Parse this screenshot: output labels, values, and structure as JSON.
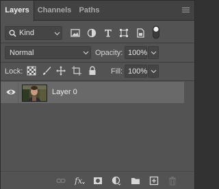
{
  "tabs": [
    {
      "label": "Layers",
      "active": true
    },
    {
      "label": "Channels",
      "active": false
    },
    {
      "label": "Paths",
      "active": false
    }
  ],
  "filter": {
    "kind_label": "Kind",
    "icons": [
      "image-filter-icon",
      "adjustment-filter-icon",
      "type-filter-icon",
      "shape-filter-icon",
      "smart-object-filter-icon",
      "filter-toggle-icon"
    ]
  },
  "blend": {
    "mode": "Normal",
    "opacity_label": "Opacity:",
    "opacity_value": "100%"
  },
  "lock": {
    "label": "Lock:",
    "icons": [
      "lock-transparent-pixels-icon",
      "lock-image-pixels-icon",
      "lock-position-icon",
      "lock-artboard-icon",
      "lock-all-icon"
    ],
    "fill_label": "Fill:",
    "fill_value": "100%"
  },
  "layers": [
    {
      "name": "Layer 0",
      "visible": true,
      "selected": true
    }
  ],
  "bottom_icons": [
    "link-layers-icon",
    "layer-style-icon",
    "add-mask-icon",
    "adjustment-layer-icon",
    "new-group-icon",
    "new-layer-icon",
    "delete-layer-icon"
  ],
  "colors": {
    "panel_bg": "#535353",
    "tab_bg": "#424242",
    "selected_row": "#696969",
    "text": "#d6d6d6"
  }
}
